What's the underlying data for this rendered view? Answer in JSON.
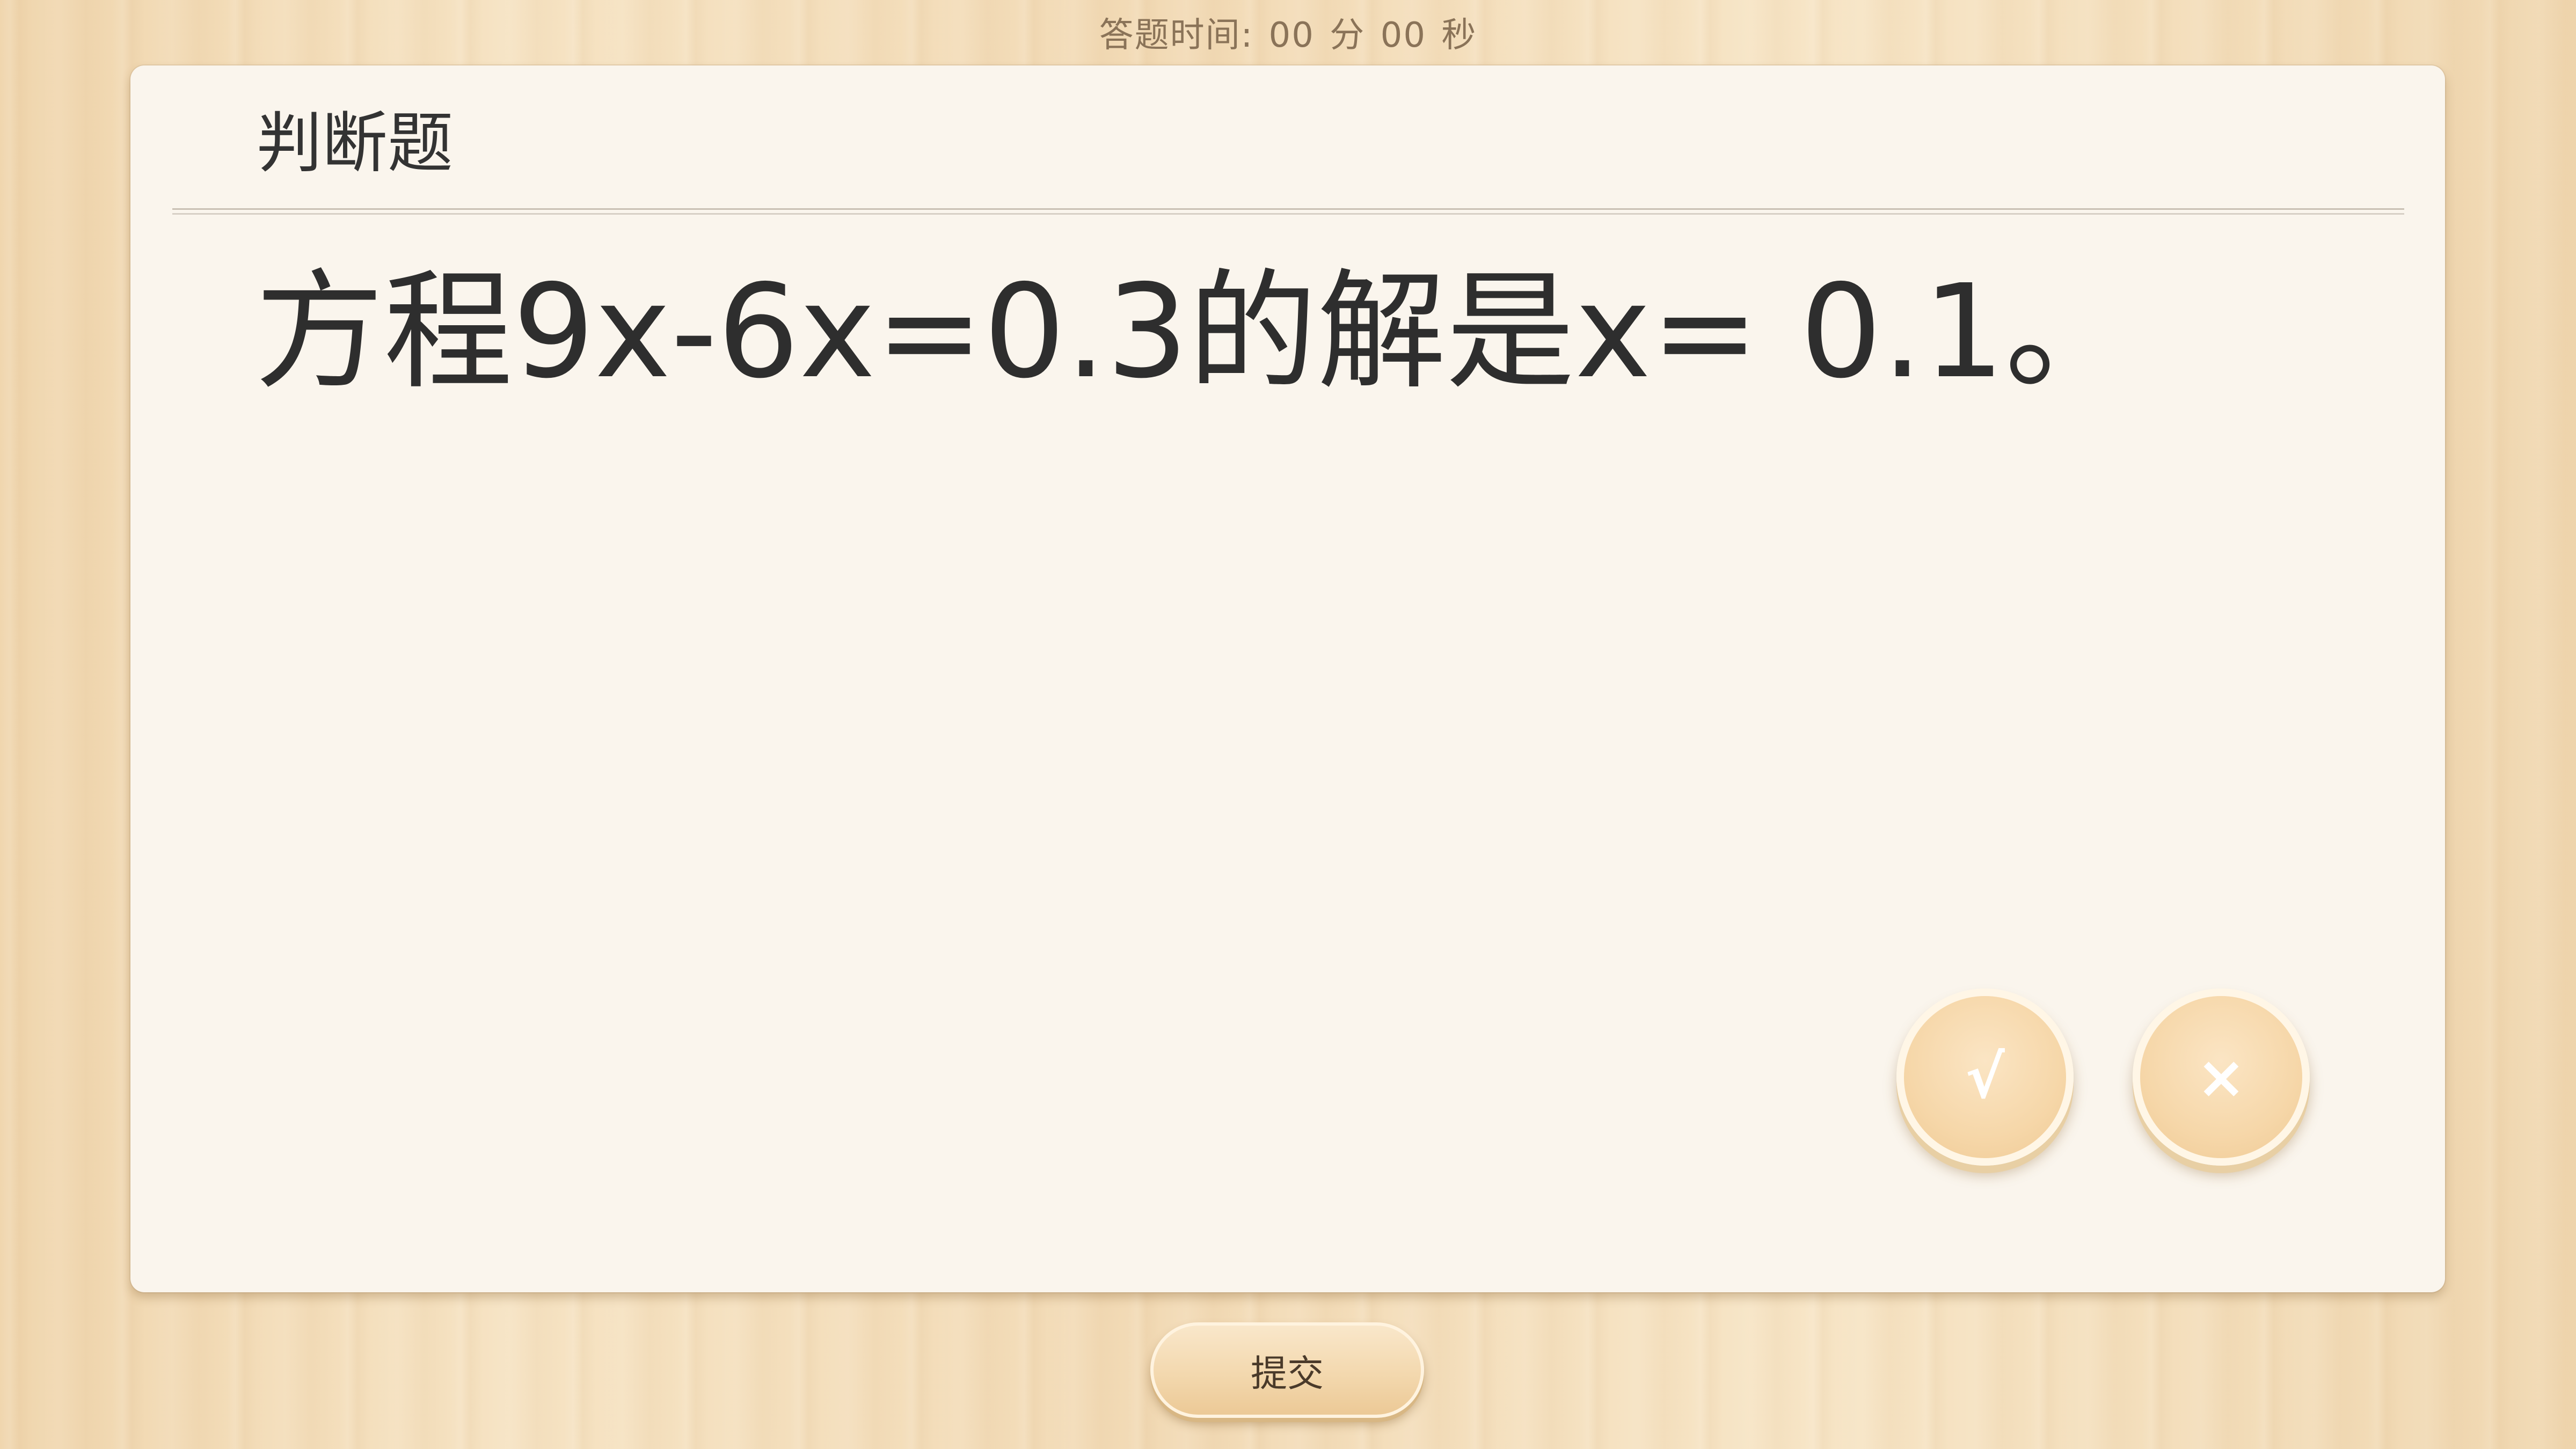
{
  "timer": {
    "label": "答题时间:",
    "minutes": "00",
    "minutes_unit": "分",
    "seconds": "00",
    "seconds_unit": "秒"
  },
  "question_type": "判断题",
  "question_text": "方程9x-6x=0.3的解是x= 0.1。",
  "answers": {
    "true_symbol": "√",
    "false_symbol": "×"
  },
  "submit_label": "提交"
}
